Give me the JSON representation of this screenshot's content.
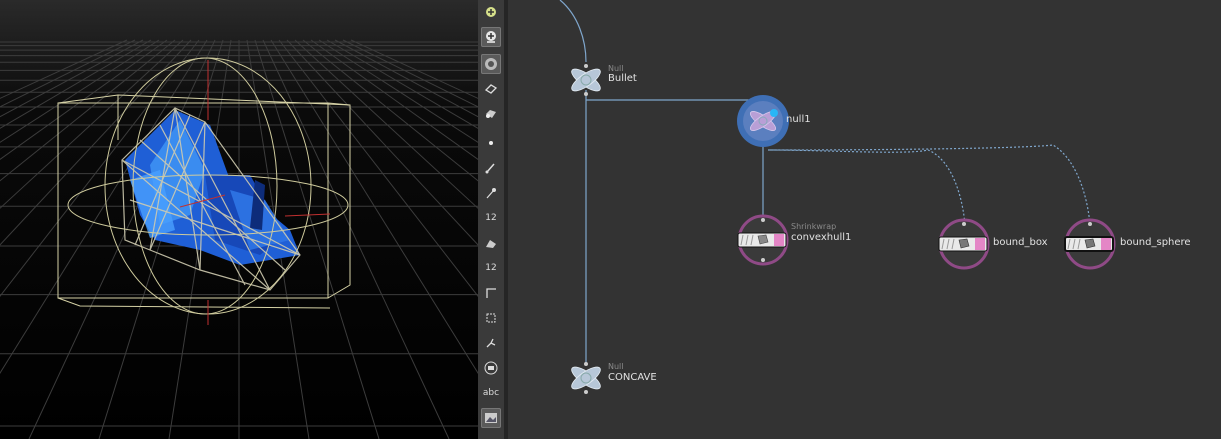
{
  "viewport": {
    "background": "#000000",
    "grid_color": "#3a3a3a",
    "bound_color": "#d8d4a8",
    "mesh_color": "#1e5fd8"
  },
  "toolbar": {
    "items": [
      {
        "icon": "snap-icon"
      },
      {
        "icon": "display-options-icon"
      },
      {
        "icon": "shading-icon"
      },
      {
        "icon": "camera-icon"
      },
      {
        "icon": "light-camera-icon"
      },
      {
        "icon": "point-icon"
      },
      {
        "icon": "brush-icon"
      },
      {
        "icon": "pen-icon"
      },
      {
        "icon": "point-numbers-icon",
        "label": "12"
      },
      {
        "icon": "primitive-icon"
      },
      {
        "icon": "primitive-numbers-icon",
        "label": "12"
      },
      {
        "icon": "edge-icon"
      },
      {
        "icon": "bounding-box-icon"
      },
      {
        "icon": "normals-icon"
      },
      {
        "icon": "template-icon"
      },
      {
        "icon": "text-icon",
        "label": "abc"
      },
      {
        "icon": "background-image-icon"
      }
    ]
  },
  "network": {
    "background": "#333333",
    "wire_color": "#7fa6cc",
    "nodes": [
      {
        "id": "bullet",
        "type": "Null",
        "name": "Bullet"
      },
      {
        "id": "null1",
        "type": "",
        "name": "null1"
      },
      {
        "id": "convexhull1",
        "type": "Shrinkwrap",
        "name": "convexhull1"
      },
      {
        "id": "bound_box",
        "type": "",
        "name": "bound_box"
      },
      {
        "id": "bound_sphere",
        "type": "",
        "name": "bound_sphere"
      },
      {
        "id": "concave",
        "type": "Null",
        "name": "CONCAVE"
      }
    ]
  }
}
